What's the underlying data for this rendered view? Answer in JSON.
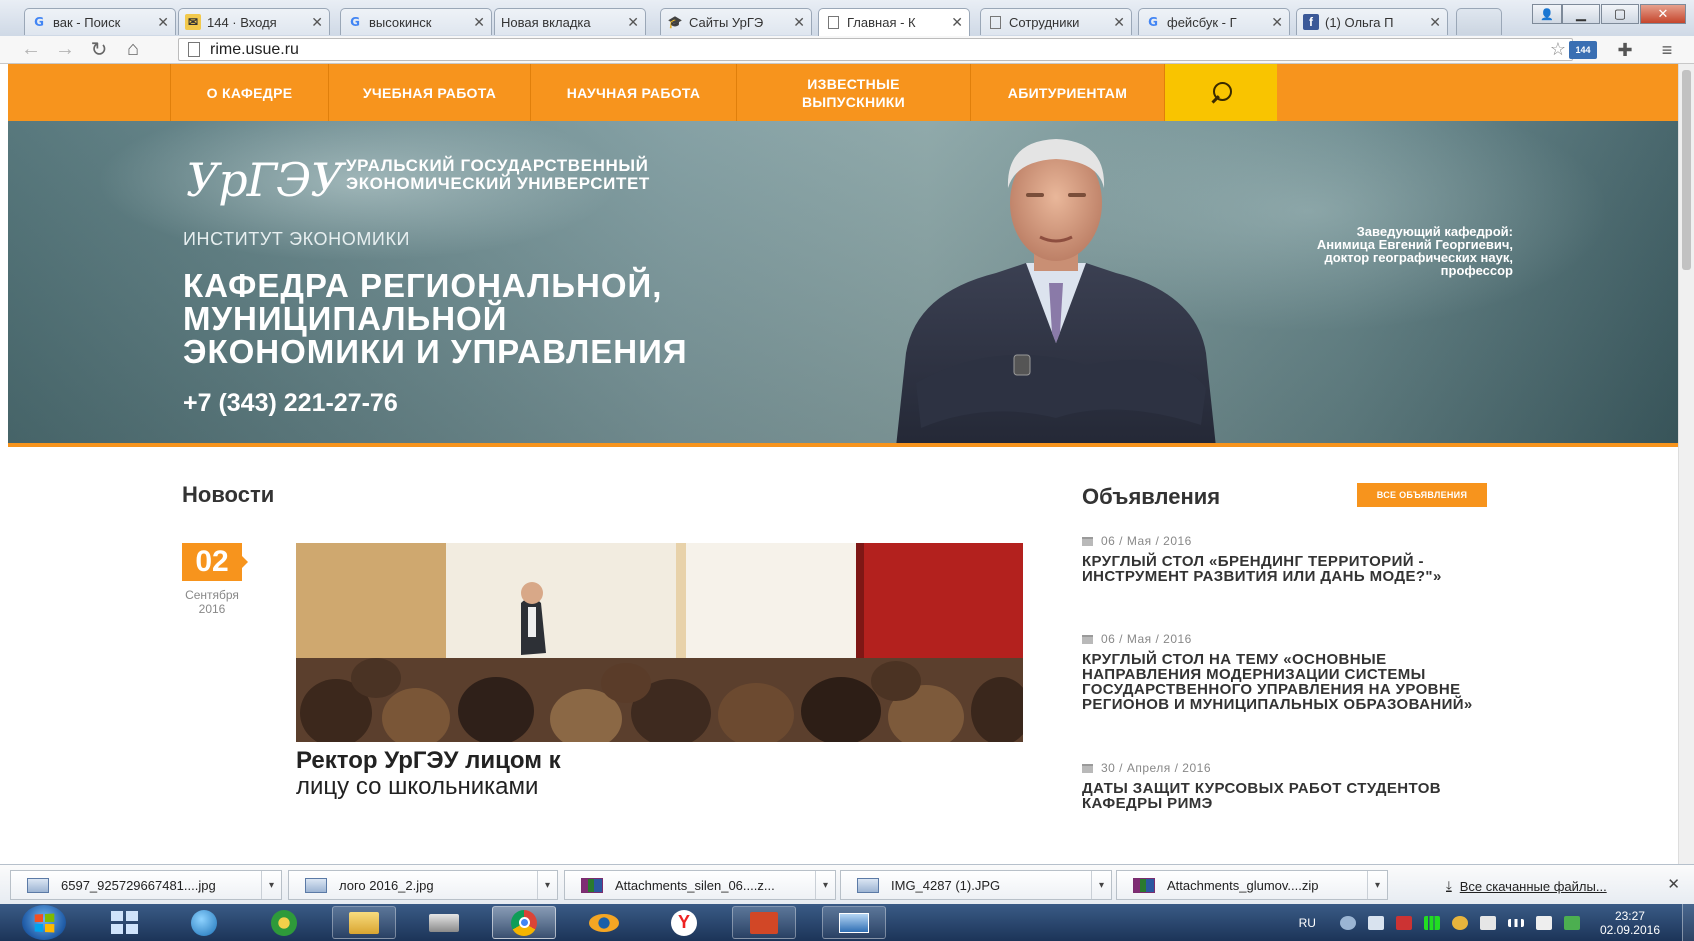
{
  "browser": {
    "tabs": [
      {
        "favicon": "google-icon",
        "title": "вак - Поиск"
      },
      {
        "favicon": "mail-icon",
        "title": "144 · Входя"
      },
      {
        "favicon": "google-icon",
        "title": "высокинск"
      },
      {
        "favicon": "none",
        "title": "Новая вкладка"
      },
      {
        "favicon": "graduation-cap-icon",
        "title": "Сайты УрГЭ"
      },
      {
        "favicon": "page-icon",
        "title": "Главная - К"
      },
      {
        "favicon": "page-icon",
        "title": "Сотрудники"
      },
      {
        "favicon": "google-icon",
        "title": "фейсбук - Г"
      },
      {
        "favicon": "facebook-icon",
        "title": "(1) Ольга П"
      }
    ],
    "active_tab": 5,
    "url": "rime.usue.ru",
    "extension_badge": "144"
  },
  "site": {
    "nav": [
      "О КАФЕДРЕ",
      "УЧЕБНАЯ РАБОТА",
      "НАУЧНАЯ РАБОТА",
      "ИЗВЕСТНЫЕ ВЫПУСКНИКИ",
      "АБИТУРИЕНТАМ"
    ],
    "logo_mark": "УрГЭУ",
    "logo_line1": "УРАЛЬСКИЙ ГОСУДАРСТВЕННЫЙ",
    "logo_line2": "ЭКОНОМИЧЕСКИЙ УНИВЕРСИТЕТ",
    "institute": "ИНСТИТУТ ЭКОНОМИКИ",
    "dept_line1": "КАФЕДРА РЕГИОНАЛЬНОЙ,",
    "dept_line2": "МУНИЦИПАЛЬНОЙ",
    "dept_line3": "ЭКОНОМИКИ И УПРАВЛЕНИЯ",
    "phone": "+7 (343) 221-27-76",
    "head": {
      "role": "Заведующий кафедрой:",
      "name": "Анимица Евгений Георгиевич,",
      "degree": "доктор географических наук,",
      "title": "профессор"
    }
  },
  "news": {
    "heading": "Новости",
    "day": "02",
    "month": "Сентября",
    "year": "2016",
    "headline_bold": "Ректор УрГЭУ лицом к",
    "headline_rest": "лицу со школьниками"
  },
  "announcements": {
    "heading": "Объявления",
    "all_button": "ВСЕ ОБЪЯВЛЕНИЯ",
    "items": [
      {
        "date": "06 / Мая / 2016",
        "text": "КРУГЛЫЙ СТОЛ «БРЕНДИНГ ТЕРРИТОРИЙ - ИНСТРУМЕНТ РАЗВИТИЯ ИЛИ ДАНЬ МОДЕ?\"»"
      },
      {
        "date": "06 / Мая / 2016",
        "text": "КРУГЛЫЙ СТОЛ НА ТЕМУ «ОСНОВНЫЕ НАПРАВЛЕНИЯ МОДЕРНИЗАЦИИ СИСТЕМЫ ГОСУДАРСТВЕННОГО УПРАВЛЕНИЯ НА УРОВНЕ РЕГИОНОВ И МУНИЦИПАЛЬНЫХ ОБРАЗОВАНИЙ»"
      },
      {
        "date": "30 / Апреля / 2016",
        "text": "ДАТЫ ЗАЩИТ КУРСОВЫХ РАБОТ СТУДЕНТОВ КАФЕДРЫ РИМЭ"
      }
    ]
  },
  "downloads": {
    "items": [
      "6597_925729667481....jpg",
      "лого 2016_2.jpg",
      "Attachments_silen_06....z...",
      "IMG_4287 (1).JPG",
      "Attachments_glumov....zip"
    ],
    "all_link": "Все скачанные файлы..."
  },
  "taskbar": {
    "language": "RU",
    "time": "23:27",
    "date": "02.09.2016"
  },
  "colors": {
    "accent_orange": "#f7941d",
    "search_yellow": "#f9c400"
  }
}
